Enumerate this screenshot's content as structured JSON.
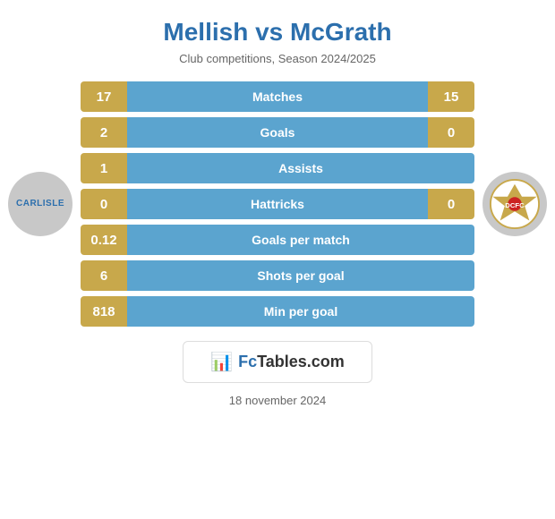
{
  "title": "Mellish vs McGrath",
  "subtitle": "Club competitions, Season 2024/2025",
  "stats": [
    {
      "id": "matches",
      "label": "Matches",
      "left": "17",
      "right": "15",
      "hasRight": true
    },
    {
      "id": "goals",
      "label": "Goals",
      "left": "2",
      "right": "0",
      "hasRight": true,
      "fillBar": true
    },
    {
      "id": "assists",
      "label": "Assists",
      "left": "1",
      "right": "",
      "hasRight": false
    },
    {
      "id": "hattricks",
      "label": "Hattricks",
      "left": "0",
      "right": "0",
      "hasRight": true
    },
    {
      "id": "goals-per-match",
      "label": "Goals per match",
      "left": "0.12",
      "right": "",
      "hasRight": false
    },
    {
      "id": "shots-per-goal",
      "label": "Shots per goal",
      "left": "6",
      "right": "",
      "hasRight": false
    },
    {
      "id": "min-per-goal",
      "label": "Min per goal",
      "left": "818",
      "right": "",
      "hasRight": false
    }
  ],
  "fctables": {
    "icon": "📊",
    "label_fc": "Fc",
    "label_tables": "Tables.com"
  },
  "footer_date": "18 november 2024",
  "logos": {
    "left": "CARLISLE",
    "right": "doncaster"
  }
}
